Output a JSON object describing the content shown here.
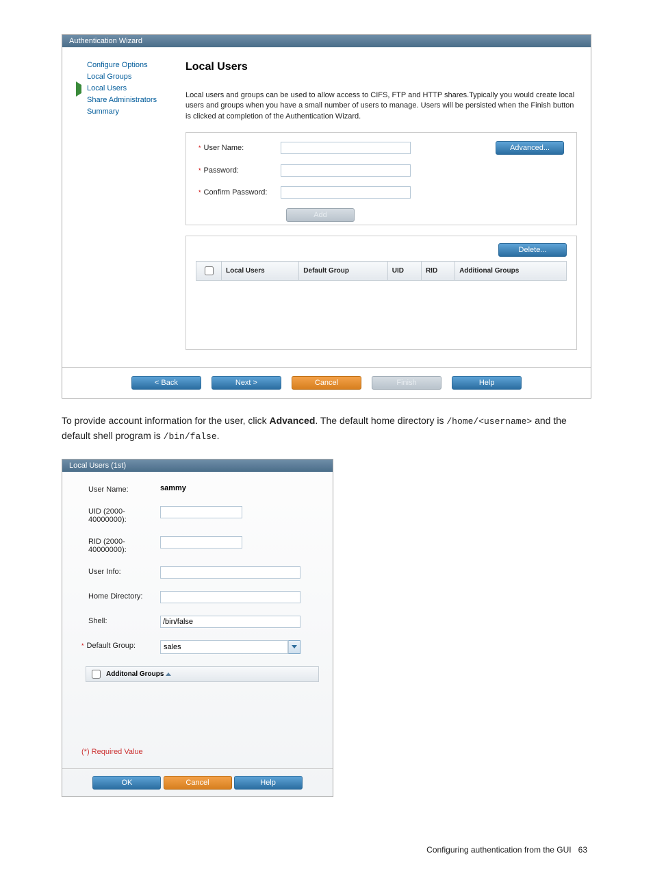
{
  "wizard": {
    "title": "Authentication Wizard",
    "nav": [
      {
        "label": "Configure Options",
        "icon": "dot"
      },
      {
        "label": "Local Groups",
        "icon": "dot"
      },
      {
        "label": "Local Users",
        "icon": "arrow"
      },
      {
        "label": "Share Administrators",
        "icon": "dot"
      },
      {
        "label": "Summary",
        "icon": "dot"
      }
    ],
    "heading": "Local Users",
    "description": "Local users and groups can be used to allow access to CIFS, FTP and HTTP shares.Typically you would create local users and groups when you have a small number of users to manage. Users will be persisted when the Finish button is clicked at completion of the Authentication Wizard.",
    "fields": {
      "username_label": "User Name:",
      "password_label": "Password:",
      "confirm_label": "Confirm Password:"
    },
    "buttons": {
      "advanced": "Advanced...",
      "add": "Add",
      "delete": "Delete...",
      "back": "< Back",
      "next": "Next >",
      "cancel": "Cancel",
      "finish": "Finish",
      "help": "Help"
    },
    "grid_headers": [
      "Local Users",
      "Default Group",
      "UID",
      "RID",
      "Additional Groups"
    ]
  },
  "paragraph": {
    "pre": "To provide account information for the user, click ",
    "bold": "Advanced",
    "mid": ". The default home directory is ",
    "code1": "/home/<username>",
    "mid2": " and the default shell program is ",
    "code2": "/bin/false",
    "end": "."
  },
  "dialog2": {
    "title": "Local Users (1st)",
    "rows": {
      "username_label": "User Name:",
      "username_value": "sammy",
      "uid_label": "UID (2000-40000000):",
      "rid_label": "RID (2000-40000000):",
      "userinfo_label": "User Info:",
      "homedir_label": "Home Directory:",
      "shell_label": "Shell:",
      "shell_value": "/bin/false",
      "defgroup_label": "Default Group:",
      "defgroup_value": "sales"
    },
    "groups_header": "Additonal Groups",
    "required_note": "(*) Required Value",
    "buttons": {
      "ok": "OK",
      "cancel": "Cancel",
      "help": "Help"
    }
  },
  "footer": {
    "text": "Configuring authentication from the GUI",
    "page": "63"
  }
}
